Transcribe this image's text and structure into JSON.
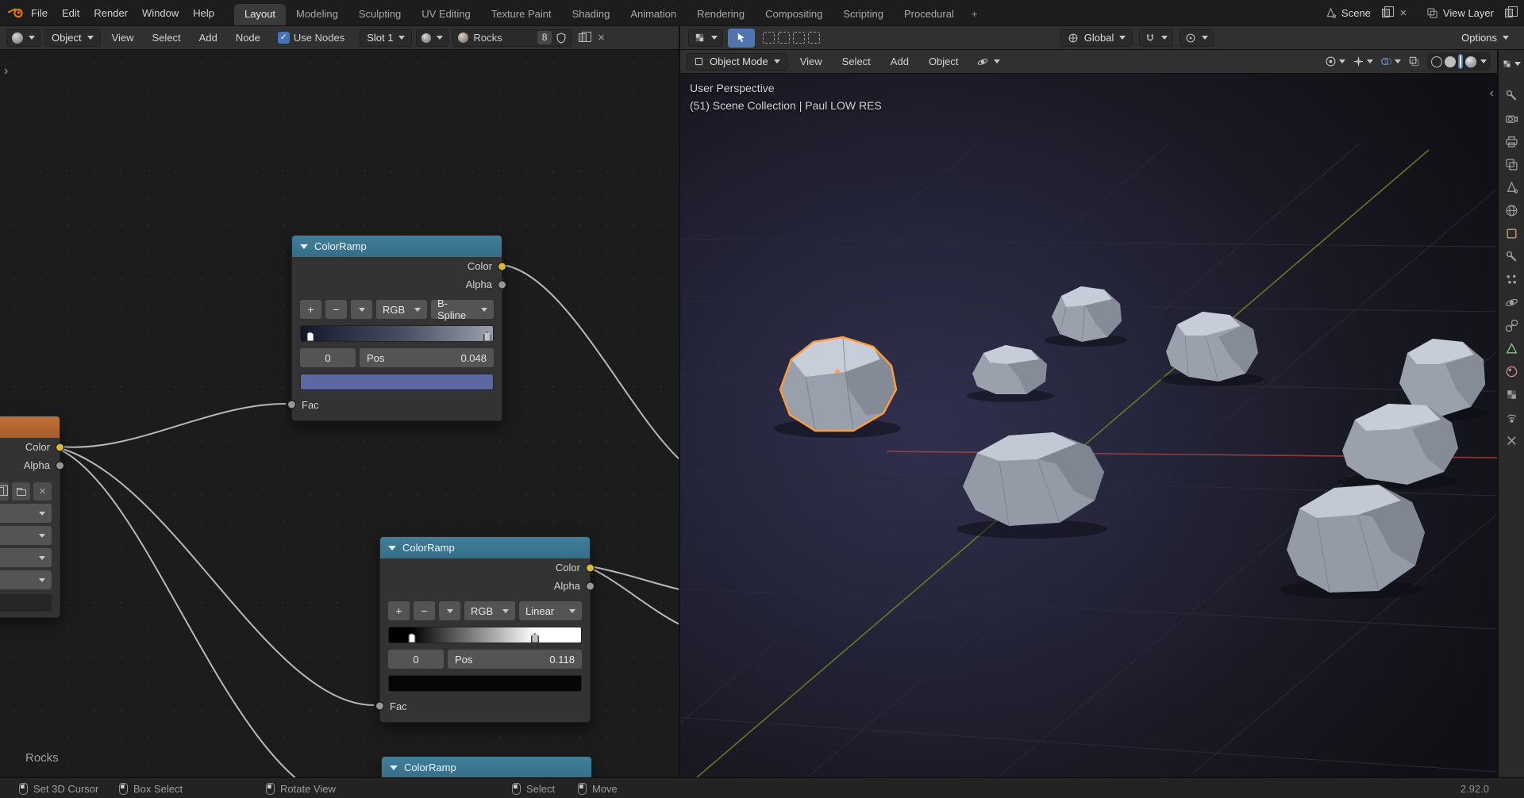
{
  "topbar": {
    "menus": [
      "File",
      "Edit",
      "Render",
      "Window",
      "Help"
    ],
    "tabs": [
      "Layout",
      "Modeling",
      "Sculpting",
      "UV Editing",
      "Texture Paint",
      "Shading",
      "Animation",
      "Rendering",
      "Compositing",
      "Scripting",
      "Procedural"
    ],
    "active_tab": "Layout",
    "add_workspace": "+",
    "scene_label": "Scene",
    "view_layer_label": "View Layer"
  },
  "shader_header": {
    "shader_type": "Object",
    "menus": [
      "View",
      "Select",
      "Add",
      "Node"
    ],
    "use_nodes": "Use Nodes",
    "use_nodes_checked": true,
    "slot": "Slot 1",
    "material_name": "Rocks",
    "material_users": "8"
  },
  "tool_header": {
    "orientation": "Global",
    "options": "Options"
  },
  "viewport_header": {
    "mode": "Object Mode",
    "menus": [
      "View",
      "Select",
      "Add",
      "Object"
    ]
  },
  "viewport": {
    "view_label": "User Perspective",
    "collection_label": "(51) Scene Collection | Paul LOW RES"
  },
  "node_editor": {
    "breadcrumb": "Rocks",
    "ramp_controls": {
      "add": "+",
      "remove": "−"
    },
    "nodes": {
      "ramp1": {
        "title": "ColorRamp",
        "outputs": [
          "Color",
          "Alpha"
        ],
        "color_mode": "RGB",
        "interpolation": "B-Spline",
        "index": "0",
        "pos_label": "Pos",
        "pos_value": "0.048",
        "input_label": "Fac",
        "swatch": "#5d68a1",
        "stops": [
          "#121421 0%",
          "#1c2033 8%",
          "#4a5163 55%",
          "#99a1ad 100%"
        ],
        "handles": [
          {
            "pos": 4.8,
            "selected": true
          },
          {
            "pos": 97,
            "selected": false
          }
        ]
      },
      "ramp2": {
        "title": "ColorRamp",
        "outputs": [
          "Color",
          "Alpha"
        ],
        "color_mode": "RGB",
        "interpolation": "Linear",
        "index": "0",
        "pos_label": "Pos",
        "pos_value": "0.118",
        "input_label": "Fac",
        "swatch": "#060606",
        "stops": [
          "#000000 0%",
          "#000000 11.8%",
          "#ffffff 76%",
          "#ffffff 100%"
        ],
        "handles": [
          {
            "pos": 11.8,
            "selected": true
          },
          {
            "pos": 76,
            "selected": false
          }
        ]
      },
      "ramp3": {
        "title": "ColorRamp"
      },
      "image_node": {
        "outputs": [
          "Color",
          "Alpha"
        ]
      }
    }
  },
  "properties_tabs": [
    "active-tool",
    "render",
    "output",
    "view-layer",
    "scene",
    "world",
    "object",
    "modifiers",
    "particles",
    "physics",
    "constraints",
    "object-data",
    "material",
    "texture",
    "probe",
    "close"
  ],
  "status_bar": {
    "items": [
      "Set 3D Cursor",
      "Box Select",
      "Rotate View",
      "Select",
      "Move"
    ],
    "version": "2.92.0"
  },
  "colors": {
    "accent_blue": "#4772b3",
    "selection_orange": "#ff9d3b",
    "node_header_converter": "#38768f",
    "node_header_texture": "#b46a33",
    "socket_yellow": "#d7b93d",
    "socket_gray": "#979797",
    "axis_x_red": "#a04040",
    "axis_y_green": "#6b8422"
  }
}
